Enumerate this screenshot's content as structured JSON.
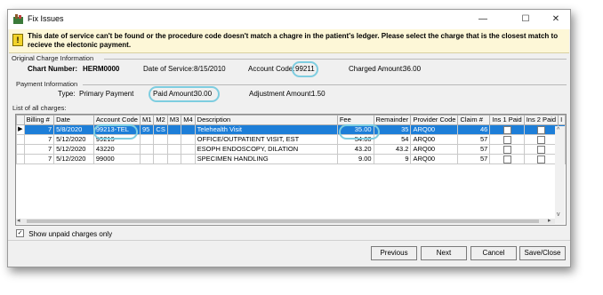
{
  "window": {
    "title": "Fix Issues",
    "minimize": "—",
    "maximize": "☐",
    "close": "✕"
  },
  "banner": {
    "icon": "!",
    "message": "This date of service can't be found or the procedure code doesn't match a chagre in the patient's ledger.  Please select the charge that is the closest match to recieve the electonic payment."
  },
  "original_charge": {
    "group_label": "Original Charge Information",
    "chart_number_label": "Chart Number:",
    "chart_number": "HERM0000",
    "date_of_service_label": "Date of Service:",
    "date_of_service": "8/15/2010",
    "account_code_label": "Account Code:",
    "account_code": "99211",
    "charged_amount_label": "Charged Amount:",
    "charged_amount": "36.00"
  },
  "payment": {
    "group_label": "Payment Information",
    "type_label": "Type:",
    "type": "Primary Payment",
    "paid_amount_label": "Paid Amount:",
    "paid_amount": "30.00",
    "adjustment_label": "Adjustment Amount:",
    "adjustment": "1.50"
  },
  "charges": {
    "label": "List of all charges:",
    "columns": [
      "Billing #",
      "Date",
      "Account Code",
      "M1",
      "M2",
      "M3",
      "M4",
      "Description",
      "Fee",
      "Remainder",
      "Provider Code",
      "Claim #",
      "Ins 1 Paid",
      "Ins 2 Paid",
      "I"
    ],
    "rows": [
      {
        "billing": "7",
        "date": "5/8/2020",
        "account_code": "99213-TEL",
        "m1": "95",
        "m2": "CS",
        "m3": "",
        "m4": "",
        "description": "Telehealth Visit",
        "fee": "35.00",
        "remainder": "35",
        "provider": "ARQ00",
        "claim": "46"
      },
      {
        "billing": "7",
        "date": "5/12/2020",
        "account_code": "99213",
        "m1": "",
        "m2": "",
        "m3": "",
        "m4": "",
        "description": "OFFICE/OUTPATIENT VISIT, EST",
        "fee": "54.00",
        "remainder": "54",
        "provider": "ARQ00",
        "claim": "57"
      },
      {
        "billing": "7",
        "date": "5/12/2020",
        "account_code": "43220",
        "m1": "",
        "m2": "",
        "m3": "",
        "m4": "",
        "description": "ESOPH ENDOSCOPY, DILATION",
        "fee": "43.20",
        "remainder": "43.2",
        "provider": "ARQ00",
        "claim": "57"
      },
      {
        "billing": "7",
        "date": "5/12/2020",
        "account_code": "99000",
        "m1": "",
        "m2": "",
        "m3": "",
        "m4": "",
        "description": "SPECIMEN HANDLING",
        "fee": "9.00",
        "remainder": "9",
        "provider": "ARQ00",
        "claim": "57"
      }
    ],
    "selected_row": 0
  },
  "filter": {
    "show_unpaid_label": "Show unpaid charges only",
    "checked": true
  },
  "buttons": {
    "previous": "Previous",
    "next": "Next",
    "cancel": "Cancel",
    "save_close": "Save/Close"
  },
  "colors": {
    "selection": "#1d7ed8",
    "highlight_ring": "#7ecde0",
    "banner": "#fdf7d7"
  }
}
